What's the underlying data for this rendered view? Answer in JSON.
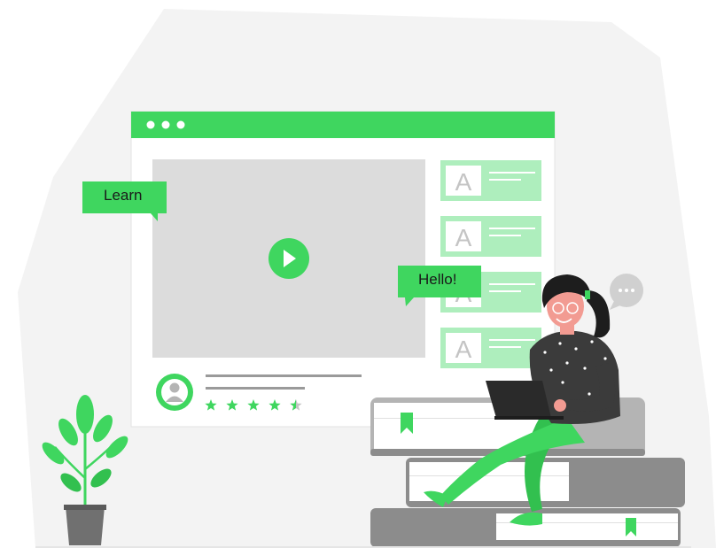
{
  "colors": {
    "accent": "#3fd65f",
    "accent_light": "#aeeebd",
    "blob": "#f3f3f3",
    "screen": "#dcdcdc",
    "book_dark": "#8c8c8c",
    "book_mid": "#b4b4b4",
    "hair": "#1d1d1d",
    "skin": "#f29b92",
    "sweater": "#3b3b3b",
    "pot": "#707070"
  },
  "bubbles": {
    "learn": "Learn",
    "hello": "Hello!"
  },
  "window": {
    "dots": 3,
    "thumbnail_letter": "A",
    "thumbnail_count": 4
  },
  "rating": {
    "stars": 4.5,
    "max": 5
  },
  "icons": {
    "play": "play-icon",
    "avatar": "user-avatar-icon",
    "chat": "chat-bubble-icon",
    "bookmark": "bookmark-icon",
    "plant": "plant-icon"
  }
}
